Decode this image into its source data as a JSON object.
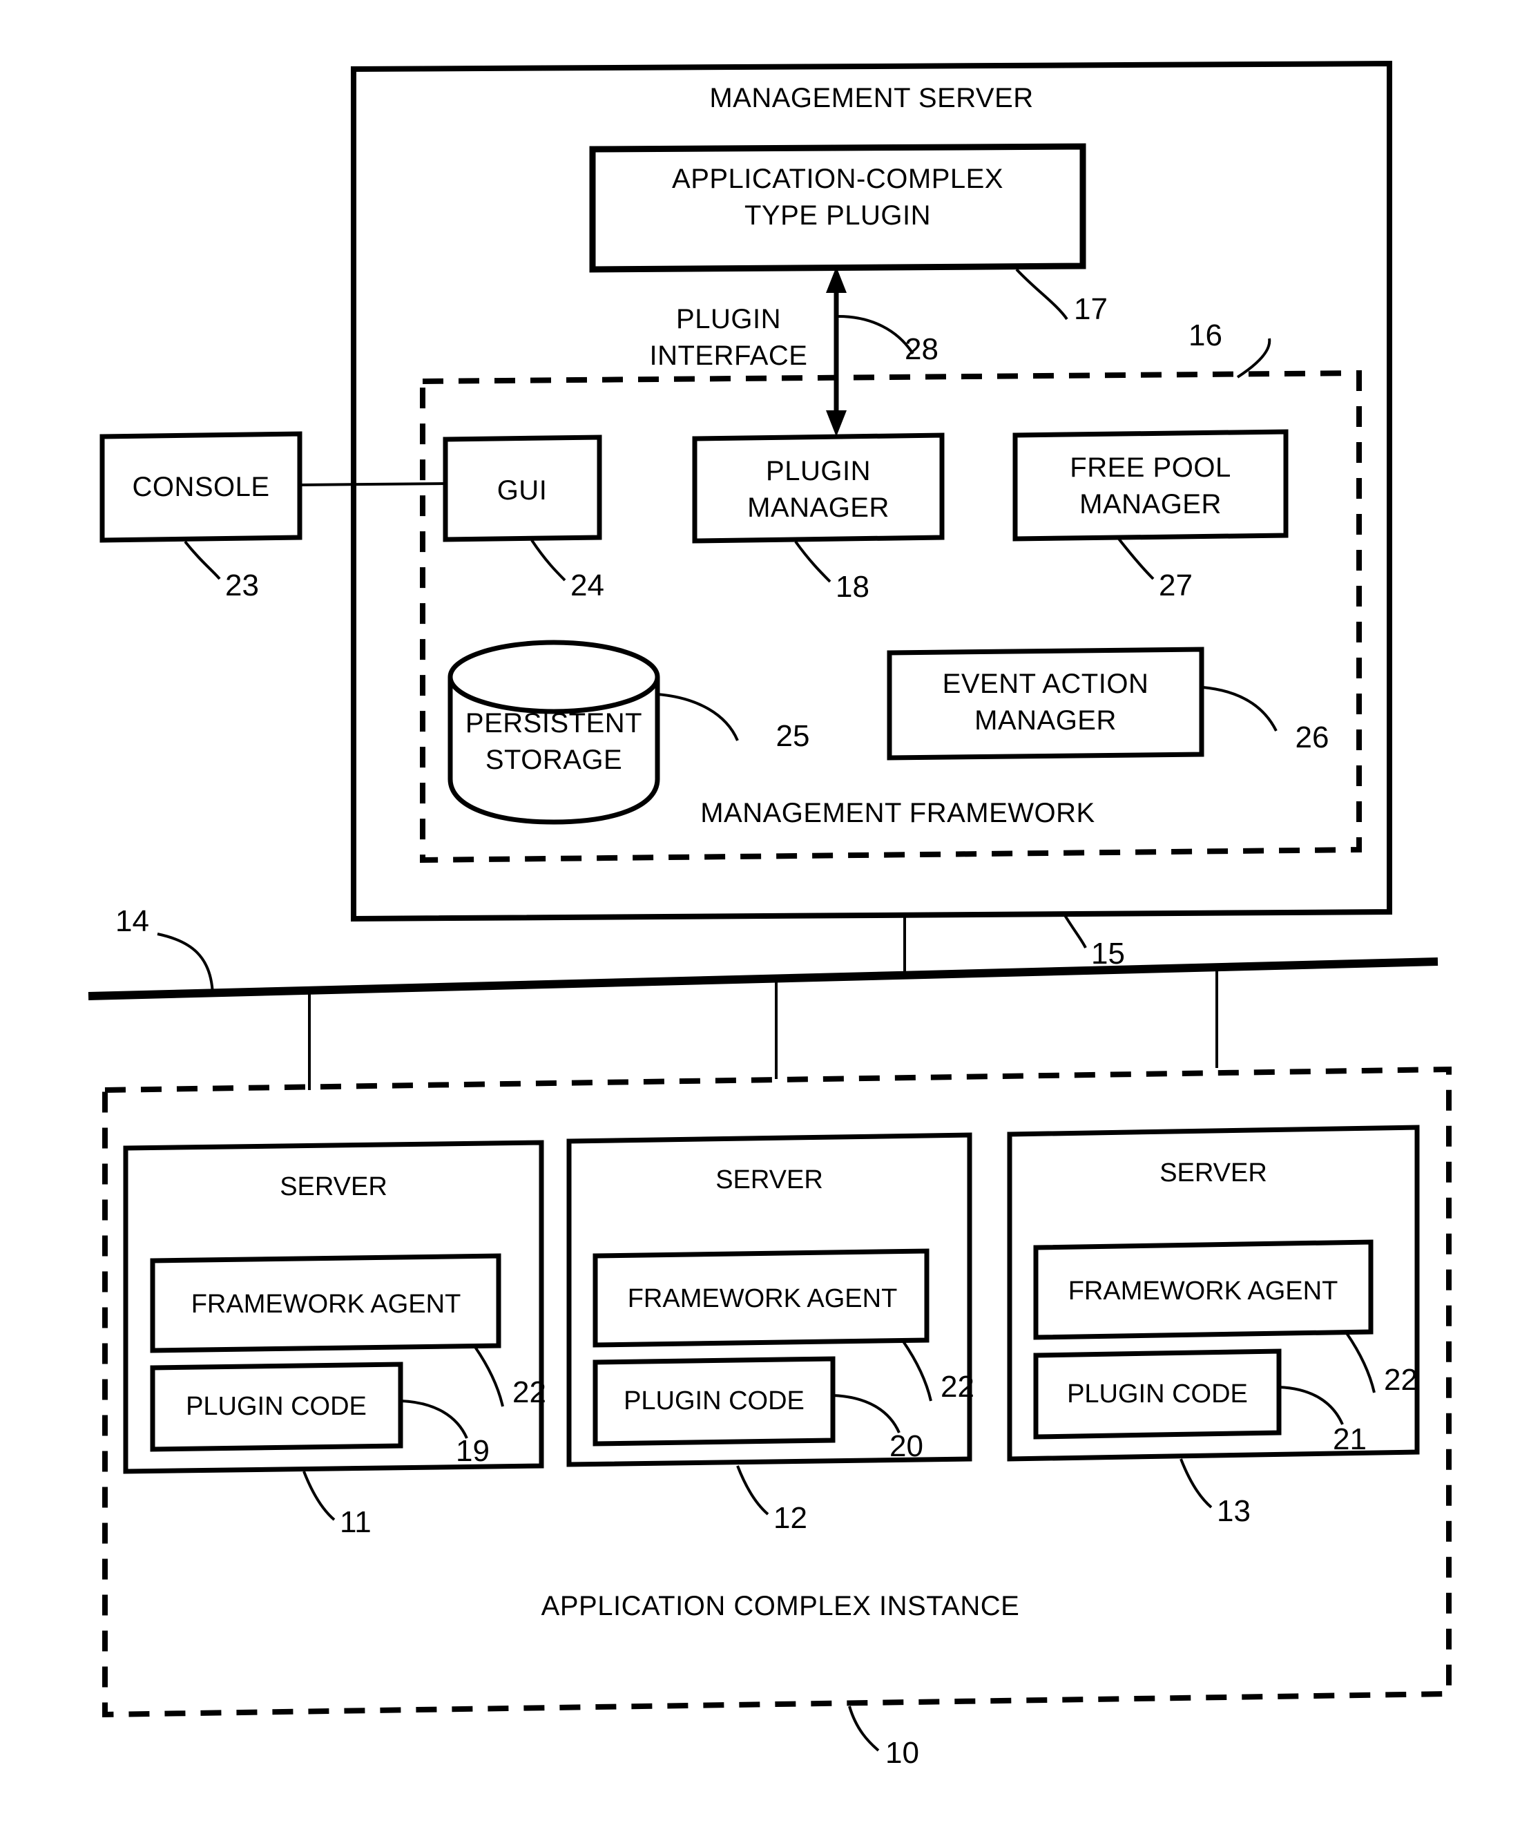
{
  "figure": {
    "type": "patent-block-diagram",
    "title": "Management server and application complex instance block diagram"
  },
  "management_server": {
    "label": "MANAGEMENT SERVER",
    "ref": "15"
  },
  "plugin_box": {
    "line1": "APPLICATION-COMPLEX",
    "line2": "TYPE PLUGIN",
    "ref": "17"
  },
  "plugin_interface": {
    "line1": "PLUGIN",
    "line2": "INTERFACE",
    "ref": "28"
  },
  "management_framework": {
    "label": "MANAGEMENT FRAMEWORK",
    "ref": "16"
  },
  "console": {
    "label": "CONSOLE",
    "ref": "23"
  },
  "gui": {
    "label": "GUI",
    "ref": "24"
  },
  "plugin_manager": {
    "line1": "PLUGIN",
    "line2": "MANAGER",
    "ref": "18"
  },
  "free_pool_manager": {
    "line1": "FREE POOL",
    "line2": "MANAGER",
    "ref": "27"
  },
  "persistent_storage": {
    "line1": "PERSISTENT",
    "line2": "STORAGE",
    "ref": "25"
  },
  "event_action_manager": {
    "line1": "EVENT ACTION",
    "line2": "MANAGER",
    "ref": "26"
  },
  "network": {
    "ref": "14"
  },
  "application_complex": {
    "label": "APPLICATION COMPLEX INSTANCE",
    "ref": "10"
  },
  "servers": [
    {
      "label": "SERVER",
      "ref": "11",
      "framework_agent": {
        "label": "FRAMEWORK AGENT",
        "ref": "22"
      },
      "plugin_code": {
        "label": "PLUGIN CODE",
        "ref": "19"
      }
    },
    {
      "label": "SERVER",
      "ref": "12",
      "framework_agent": {
        "label": "FRAMEWORK AGENT",
        "ref": "22"
      },
      "plugin_code": {
        "label": "PLUGIN CODE",
        "ref": "20"
      }
    },
    {
      "label": "SERVER",
      "ref": "13",
      "framework_agent": {
        "label": "FRAMEWORK AGENT",
        "ref": "22"
      },
      "plugin_code": {
        "label": "PLUGIN CODE",
        "ref": "21"
      }
    }
  ],
  "colors": {
    "ink": "#000000",
    "paper": "#ffffff"
  }
}
